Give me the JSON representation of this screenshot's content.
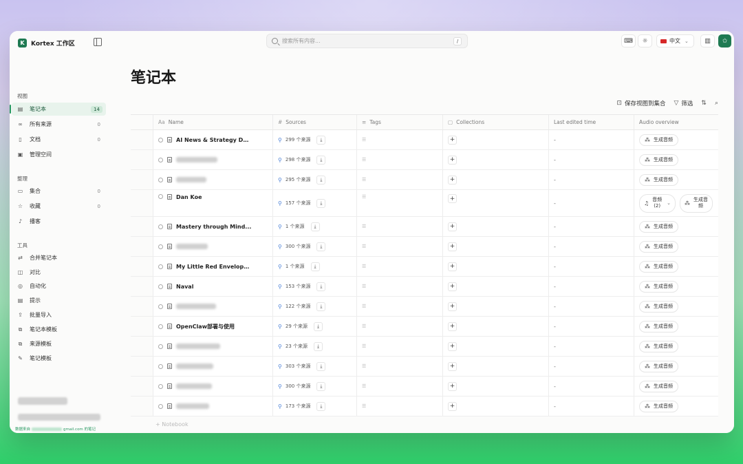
{
  "app": {
    "logo_letter": "K",
    "name": "Kortex 工作区"
  },
  "sidebar": {
    "sections": [
      {
        "title": "视图",
        "items": [
          {
            "label": "笔记本",
            "icon": "notebook-icon",
            "count": "14",
            "active": true
          },
          {
            "label": "所有来源",
            "icon": "link-icon",
            "count": "0"
          },
          {
            "label": "文档",
            "icon": "document-icon",
            "count": "0"
          },
          {
            "label": "管理空间",
            "icon": "space-icon",
            "count": ""
          }
        ]
      },
      {
        "title": "整理",
        "items": [
          {
            "label": "集合",
            "icon": "folder-icon",
            "count": "0"
          },
          {
            "label": "收藏",
            "icon": "star-icon",
            "count": "0"
          },
          {
            "label": "播客",
            "icon": "microphone-icon",
            "count": ""
          }
        ]
      },
      {
        "title": "工具",
        "items": [
          {
            "label": "合并笔记本",
            "icon": "merge-icon",
            "count": ""
          },
          {
            "label": "对比",
            "icon": "compare-icon",
            "count": ""
          },
          {
            "label": "自动化",
            "icon": "automation-icon",
            "count": ""
          },
          {
            "label": "提示",
            "icon": "prompt-icon",
            "count": ""
          },
          {
            "label": "批量导入",
            "icon": "upload-icon",
            "count": ""
          },
          {
            "label": "笔记本模板",
            "icon": "template-icon",
            "count": ""
          },
          {
            "label": "来源模板",
            "icon": "template-icon",
            "count": ""
          },
          {
            "label": "笔记模板",
            "icon": "edit-icon",
            "count": ""
          }
        ]
      }
    ],
    "footer_prefix": "数据来自",
    "footer_suffix": "gmail.com 的笔记"
  },
  "topbar": {
    "search_placeholder": "搜索所有内容...",
    "search_shortcut": "/",
    "language": "中文"
  },
  "main": {
    "title": "笔记本",
    "toolbar": {
      "save_view": "保存视图到集合",
      "filter": "筛选"
    },
    "columns": [
      {
        "label": "Name",
        "icon": "Aa"
      },
      {
        "label": "Sources",
        "icon": "#"
      },
      {
        "label": "Tags",
        "icon": "≡"
      },
      {
        "label": "Collections",
        "icon": "▢"
      },
      {
        "label": "Last edited time",
        "icon": ""
      },
      {
        "label": "Audio overview",
        "icon": ""
      }
    ],
    "rows": [
      {
        "name": "AI News & Strategy Da...",
        "sources": "299 个来源"
      },
      {
        "name": "",
        "sources": "298 个来源",
        "blur_w": 60
      },
      {
        "name": "",
        "sources": "295 个来源",
        "blur_w": 44
      },
      {
        "name": "Dan Koe",
        "sources": "157 个来源",
        "tall": true,
        "audio": "音频\n(2)"
      },
      {
        "name": "Mastery through Mind...",
        "sources": "1 个来源"
      },
      {
        "name": "",
        "sources": "300 个来源",
        "blur_w": 46
      },
      {
        "name": "My Little Red Envelope...",
        "sources": "1 个来源"
      },
      {
        "name": "Naval",
        "sources": "153 个来源"
      },
      {
        "name": "",
        "sources": "122 个来源",
        "blur_w": 58
      },
      {
        "name": "OpenClaw部署与使用",
        "sources": "29 个来源"
      },
      {
        "name": "",
        "sources": "23 个来源",
        "blur_w": 64
      },
      {
        "name": "",
        "sources": "303 个来源",
        "blur_w": 54
      },
      {
        "name": "",
        "sources": "300 个来源",
        "blur_w": 52
      },
      {
        "name": "",
        "sources": "173 个来源",
        "blur_w": 48
      }
    ],
    "last_edited_placeholder": "-",
    "generate_audio_label": "生成音频",
    "add_row_label": "+ Notebook"
  }
}
